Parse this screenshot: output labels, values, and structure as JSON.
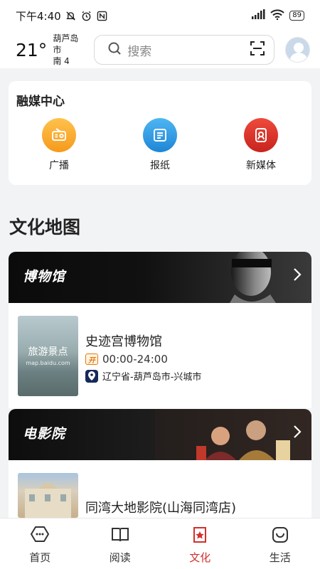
{
  "status_bar": {
    "time": "下午4:40",
    "battery": "89"
  },
  "header": {
    "temperature": "21°",
    "city": "葫芦岛市",
    "wind": "南 4",
    "search_placeholder": "搜索"
  },
  "media_center": {
    "title": "融媒中心",
    "items": [
      {
        "label": "广播",
        "icon": "radio-icon",
        "color": "#f5a623"
      },
      {
        "label": "报纸",
        "icon": "newspaper-icon",
        "color": "#2e9be6"
      },
      {
        "label": "新媒体",
        "icon": "new-media-icon",
        "color": "#d9342b"
      }
    ]
  },
  "culture_map": {
    "title": "文化地图",
    "categories": [
      {
        "banner": "博物馆",
        "entry": {
          "name": "史迹宫博物馆",
          "thumb_text": "旅游景点",
          "thumb_sub": "map.baidu.com",
          "open_badge": "开",
          "hours": "00:00-24:00",
          "address": "辽宁省-葫芦岛市-兴城市"
        }
      },
      {
        "banner": "电影院",
        "entry": {
          "name": "同湾大地影院(山海同湾店)"
        }
      }
    ]
  },
  "tabbar": {
    "tabs": [
      {
        "label": "首页",
        "icon": "home-icon"
      },
      {
        "label": "阅读",
        "icon": "book-icon"
      },
      {
        "label": "文化",
        "icon": "culture-icon",
        "active": true
      },
      {
        "label": "生活",
        "icon": "life-icon"
      }
    ],
    "active_color": "#d0312d"
  }
}
